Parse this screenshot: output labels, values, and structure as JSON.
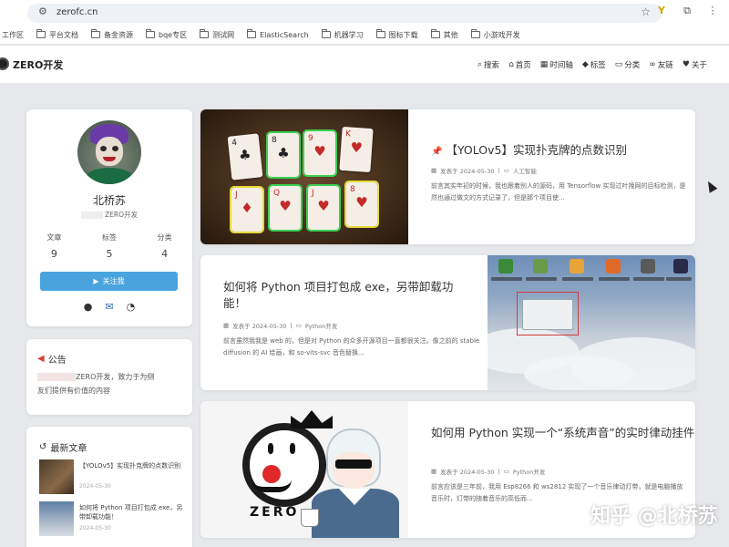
{
  "browser": {
    "url": "zerofc.cn",
    "bookmarks": [
      {
        "label": "工作区"
      },
      {
        "label": "平台文档"
      },
      {
        "label": "备金资源"
      },
      {
        "label": "bqe专区"
      },
      {
        "label": "测试网"
      },
      {
        "label": "ElasticSearch"
      },
      {
        "label": "机器学习"
      },
      {
        "label": "图标下载"
      },
      {
        "label": "其他"
      },
      {
        "label": "小游戏开发"
      }
    ]
  },
  "site": {
    "title": "ZERO开发",
    "nav": [
      {
        "icon": "search-icon",
        "glyph": "⌕",
        "label": "搜索"
      },
      {
        "icon": "home-icon",
        "glyph": "⌂",
        "label": "首页"
      },
      {
        "icon": "calendar-icon",
        "glyph": "▦",
        "label": "时间轴"
      },
      {
        "icon": "tag-icon",
        "glyph": "◆",
        "label": "标签"
      },
      {
        "icon": "folder-icon",
        "glyph": "▭",
        "label": "分类"
      },
      {
        "icon": "link-icon",
        "glyph": "∞",
        "label": "友链"
      },
      {
        "icon": "heart-icon",
        "glyph": "♥",
        "label": "关于"
      }
    ]
  },
  "profile": {
    "name": "北桥苏",
    "desc": "ZERO开发",
    "stats": [
      {
        "label": "文章",
        "value": "9"
      },
      {
        "label": "标签",
        "value": "5"
      },
      {
        "label": "分类",
        "value": "4"
      }
    ],
    "follow_label": "关注我"
  },
  "notice": {
    "title": "公告",
    "text_a": "ZERO开发，致力于为侧",
    "text_b": "友们提供有价值的内容"
  },
  "recent": {
    "title": "最新文章",
    "items": [
      {
        "title": "【YOLOv5】实现扑克牌的点数识别",
        "date": "2024-05-30"
      },
      {
        "title": "如何将 Python 项目打包成 exe，另带卸载功能！",
        "date": "2024-05-30"
      }
    ]
  },
  "posts": [
    {
      "title": "【YOLOv5】实现扑克牌的点数识别",
      "date": "发表于 2024-05-30",
      "category": "人工智能",
      "excerpt": "前言其实年初的时候，我也跟着别人的源码，用 Tensorflow 实现过叶挽网的目标检测，是然也通过做文的方式记录了，但是那个项目使..."
    },
    {
      "title": "如何将 Python 项目打包成 exe，另带卸载功能！",
      "date": "发表于 2024-05-30",
      "category": "Python开发",
      "excerpt": "前言虽然我我是 web 的，但是对 Python 的众多开源项目一直都很关注。像之前的 stable diffusion 的 AI 绘画，和 so-vits-svc 音色替换..."
    },
    {
      "title": "如何用 Python 实现一个“系统声音”的实时律动挂件",
      "date": "发表于 2024-05-30",
      "category": "Python开发",
      "excerpt": "前言应该是三年前，我用 Esp8266 和 ws2812 实现了一个音乐律动灯带，就是电脑播放音乐时，灯带的随着音乐的高低而..."
    }
  ],
  "anime_text": "ZERO",
  "watermark": "知乎 @北桥苏",
  "colors": {
    "accent": "#49a4dd",
    "pin": "#e05a2b",
    "notice_icon": "#d2453b"
  }
}
